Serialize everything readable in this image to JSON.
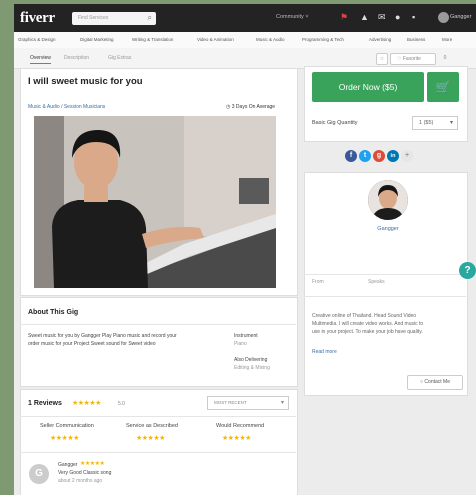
{
  "app": {
    "logo": "fiverr"
  },
  "search": {
    "placeholder": "Find Services"
  },
  "topnav": {
    "community": "Community ˅",
    "username": "Gangger"
  },
  "categories": [
    "Graphics & Design",
    "Digital Marketing",
    "Writing & Translation",
    "Video & Animation",
    "Music & Audio",
    "Programming & Tech",
    "Advertising",
    "Business",
    "More"
  ],
  "tabs": [
    "Overview",
    "Description",
    "Gig Extras"
  ],
  "favorite": {
    "label": "♡ Favorite",
    "count": "0"
  },
  "gig": {
    "title": "I will sweet music for you",
    "breadcrumb": "Music & Audio / Session Musicians",
    "delivery": "3 Days On Average"
  },
  "about": {
    "heading": "About This Gig",
    "text_line1": "Sweet music for you by Gangger Play Piano music and record your",
    "text_line2": "order music  for your Project Sweet sound for Sweet video",
    "instrument_label": "Instrument",
    "instrument_value": "Piano",
    "also_label": "Also Delivering",
    "also_value": "Editing & Mixing"
  },
  "reviews": {
    "count_label": "1 Reviews",
    "rating": "5.0",
    "sort": "MOST RECENT",
    "columns": [
      "Seller Communication",
      "Service as Described",
      "Would Recommend"
    ],
    "items": [
      {
        "initial": "G",
        "name": "Gangger",
        "text": "Very Good Classic song",
        "time": "about 2 months ago"
      }
    ]
  },
  "order": {
    "button": "Order Now ($5)",
    "quantity_label": "Basic Gig Quantity",
    "quantity_value": "1 ($5)"
  },
  "social": [
    {
      "icon": "facebook-icon",
      "glyph": "f",
      "color": "#3b5998"
    },
    {
      "icon": "twitter-icon",
      "glyph": "t",
      "color": "#1da1f2"
    },
    {
      "icon": "google-plus-icon",
      "glyph": "g",
      "color": "#dd4b39"
    },
    {
      "icon": "linkedin-icon",
      "glyph": "in",
      "color": "#0077b5"
    }
  ],
  "seller": {
    "name": "Gangger",
    "from_label": "From",
    "speaks_label": "Speaks",
    "bio_line1": "Creative online of Thailand. Head Sound Video",
    "bio_line2": "Multimedia. I will create video works. And music to",
    "bio_line3": "use in your project. To make your job have quality.",
    "read_more": "Read more",
    "contact": "Contact Me"
  },
  "colors": {
    "accent": "#3aa35b",
    "star": "#f5b800",
    "help": "#2aa8a0"
  }
}
